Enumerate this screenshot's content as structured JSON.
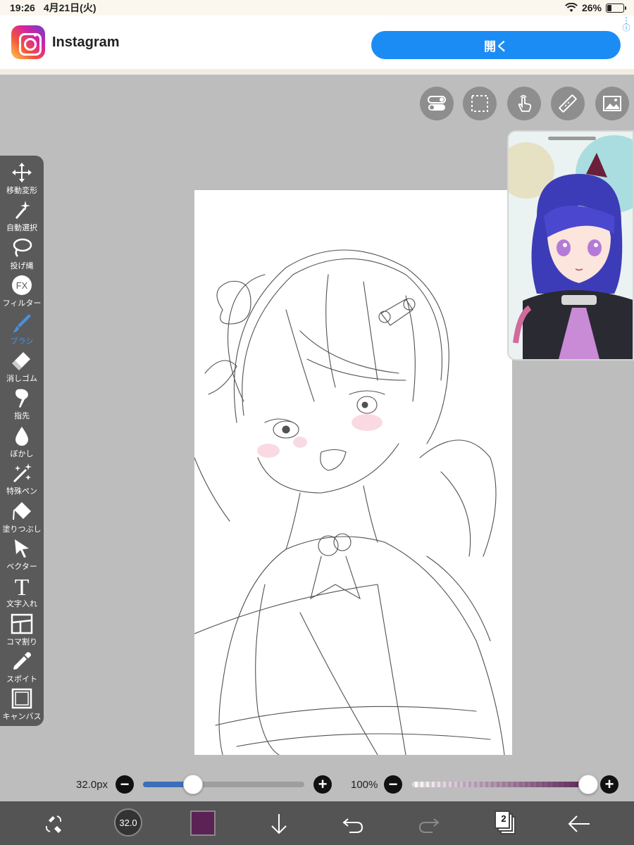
{
  "status_bar": {
    "time": "19:26",
    "date": "4月21日(火)",
    "battery": "26%",
    "battery_level": 0.26
  },
  "ad": {
    "app_name": "Instagram",
    "open_label": "開く"
  },
  "top_tools": [
    "toggle-icon",
    "selection-icon",
    "gesture-hand-icon",
    "ruler-icon",
    "reference-image-icon"
  ],
  "tools": [
    {
      "label": "移動変形",
      "icon": "move-icon"
    },
    {
      "label": "自動選択",
      "icon": "magic-wand-icon"
    },
    {
      "label": "投げ縄",
      "icon": "lasso-icon"
    },
    {
      "label": "フィルター",
      "icon": "filter-fx-icon"
    },
    {
      "label": "ブラシ",
      "icon": "brush-icon",
      "active": true
    },
    {
      "label": "消しゴム",
      "icon": "eraser-icon"
    },
    {
      "label": "指先",
      "icon": "smudge-icon"
    },
    {
      "label": "ぼかし",
      "icon": "blur-drop-icon"
    },
    {
      "label": "特殊ペン",
      "icon": "special-pen-icon"
    },
    {
      "label": "塗りつぶし",
      "icon": "bucket-icon"
    },
    {
      "label": "ベクター",
      "icon": "vector-arrow-icon"
    },
    {
      "label": "文字入れ",
      "icon": "text-icon"
    },
    {
      "label": "コマ割り",
      "icon": "frame-divider-icon"
    },
    {
      "label": "スポイト",
      "icon": "eyedropper-icon"
    },
    {
      "label": "キャンバス",
      "icon": "canvas-icon"
    }
  ],
  "brush_size": {
    "label": "32.0px",
    "value": 32.0,
    "level": 0.31
  },
  "opacity": {
    "label": "100%",
    "value": 100,
    "level": 1.0
  },
  "bottom_bar": {
    "brush_preview_label": "32.0",
    "color": "#5b2255",
    "layer_count": "2"
  },
  "colors": {
    "accent": "#1c8cf5",
    "slider_fill": "#3d6eb8",
    "active_tool": "#4a90e2"
  }
}
